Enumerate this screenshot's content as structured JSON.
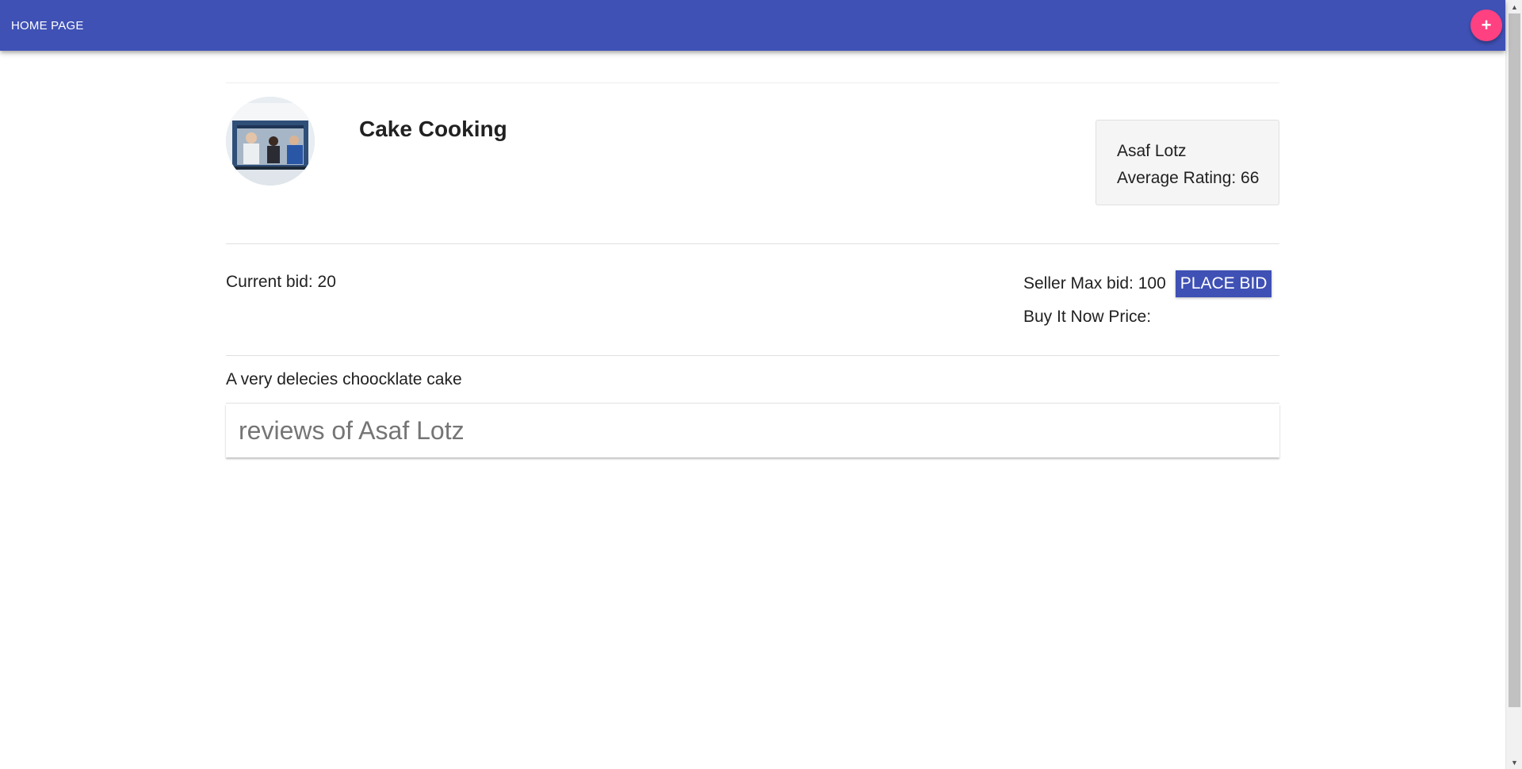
{
  "appbar": {
    "home_label": "HOME PAGE",
    "add_label": "+",
    "color": "#3f51b5",
    "fab_color": "#ff4081"
  },
  "item": {
    "title": "Cake Cooking",
    "image_icon": "auction-item-photo",
    "description": "A very delecies choocklate cake"
  },
  "seller": {
    "name": "Asaf Lotz",
    "rating_text": "Average Rating: 66"
  },
  "bid": {
    "current_bid_text": "Current bid: 20",
    "seller_max_text": "Seller Max bid: 100",
    "place_bid_label": "PLACE BID",
    "buy_now_text": "Buy It Now Price:"
  },
  "reviews": {
    "heading": "reviews of Asaf Lotz"
  }
}
